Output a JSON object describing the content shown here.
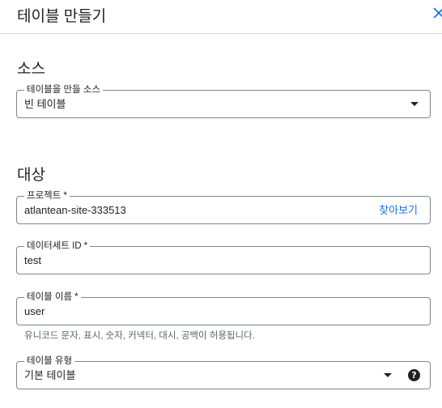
{
  "header": {
    "title": "테이블 만들기"
  },
  "source": {
    "section_title": "소스",
    "create_from_label": "테이블을 만들 소스",
    "create_from_value": "빈 테이블"
  },
  "destination": {
    "section_title": "대상",
    "project": {
      "label": "프로젝트",
      "required": "*",
      "value": "atlantean-site-333513",
      "browse_label": "찾아보기"
    },
    "dataset": {
      "label": "데이터세트 ID",
      "required": "*",
      "value": "test"
    },
    "table_name": {
      "label": "테이블 이름",
      "required": "*",
      "value": "user",
      "hint": "유니코드 문자, 표시, 숫자, 커넥터, 대시, 공백이 허용됩니다."
    },
    "table_type": {
      "label": "테이블 유형",
      "value": "기본 테이블",
      "help_glyph": "?"
    }
  },
  "icons": {
    "close": "close-icon",
    "dropdown": "chevron-down-icon",
    "help": "help-icon"
  },
  "colors": {
    "accent": "#1a73e8",
    "border": "#80868b",
    "divider": "#dadce0",
    "text": "#202124",
    "hint": "#5f6368"
  }
}
